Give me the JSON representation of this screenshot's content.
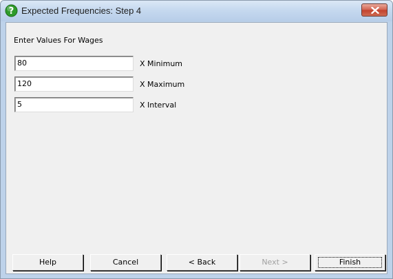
{
  "window": {
    "title": "Expected Frequencies: Step 4"
  },
  "form": {
    "heading": "Enter Values For Wages",
    "fields": [
      {
        "value": "80",
        "label": "X Minimum"
      },
      {
        "value": "120",
        "label": "X Maximum"
      },
      {
        "value": "5",
        "label": "X Interval"
      }
    ]
  },
  "buttons": {
    "help": "Help",
    "cancel": "Cancel",
    "back": "< Back",
    "next": "Next >",
    "finish": "Finish"
  },
  "icons": {
    "title": "help-question-icon",
    "close": "close-icon"
  },
  "colors": {
    "title_icon_green": "#2e9b2b",
    "close_red": "#c2412c",
    "dialog_bg": "#f0f0f0",
    "frame": "#bdd2ea"
  }
}
